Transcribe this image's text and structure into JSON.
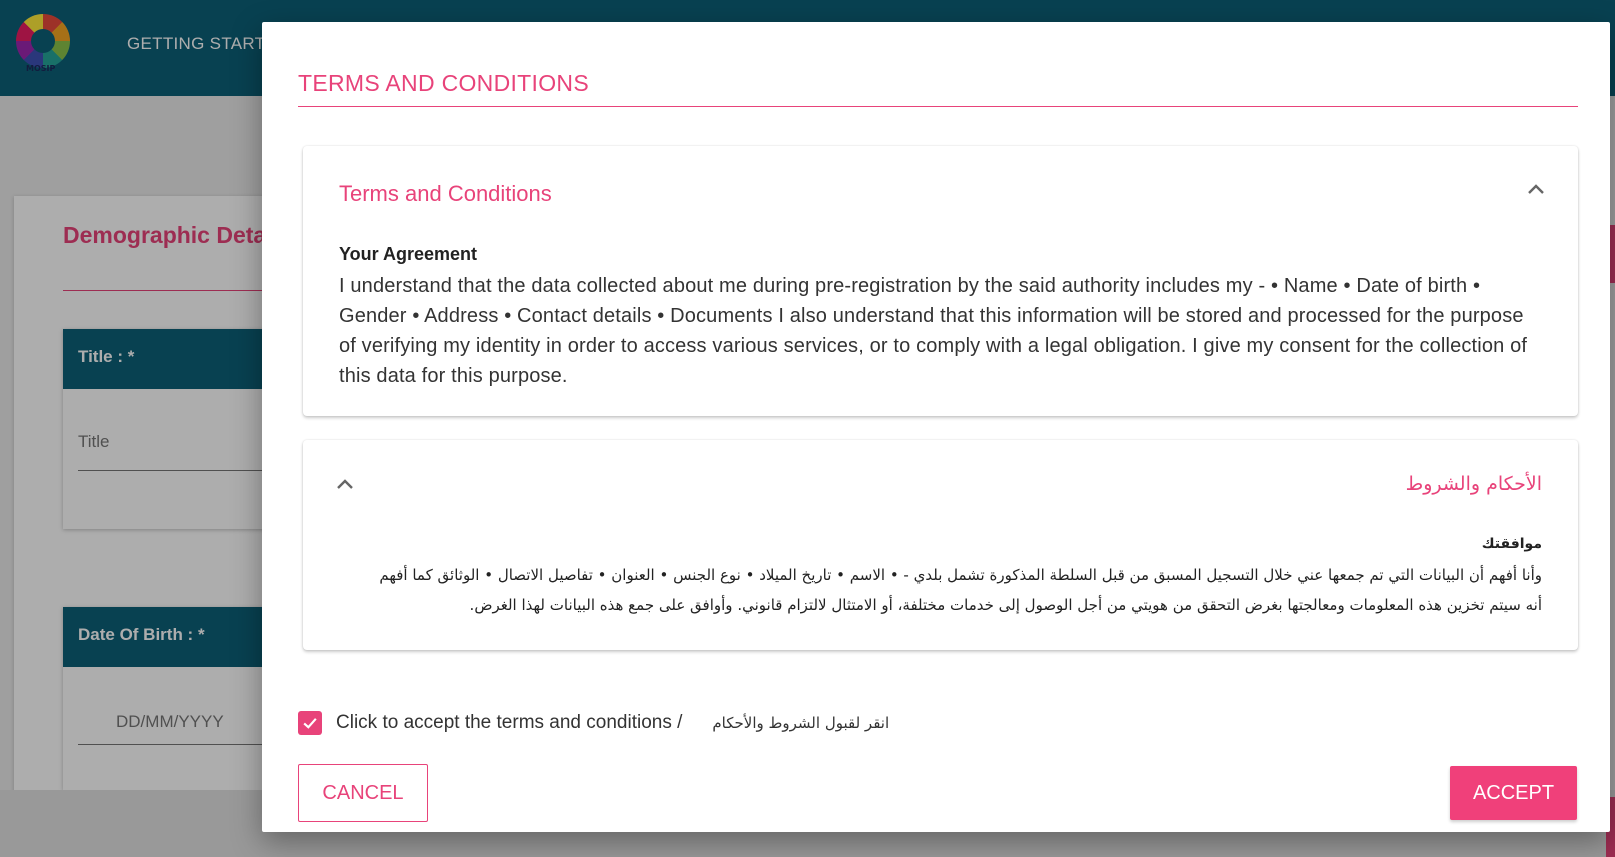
{
  "app": {
    "logo_text": "MOSIP",
    "nav_item": "GETTING STARTED",
    "section_heading": "Demographic Details",
    "fields": [
      {
        "label": "Title :  *",
        "placeholder": "Title"
      },
      {
        "label": "Date Of Birth :  *",
        "placeholder": "DD/MM/YYYY"
      }
    ]
  },
  "dialog": {
    "title": "TERMS AND CONDITIONS",
    "panels": [
      {
        "title": "Terms and Conditions",
        "heading": "Your Agreement",
        "body": "I understand that the data collected about me during pre-registration by the said authority includes my - • Name • Date of birth • Gender • Address • Contact details • Documents I also understand that this information will be stored and processed for the purpose of verifying my identity in order to access various services, or to comply with a legal obligation. I give my consent for the collection of this data for this purpose.",
        "chevron_icon": "chevron-up-icon"
      },
      {
        "title": "الأحكام والشروط",
        "heading": "موافقتك",
        "body": "وأنا أفهم أن البيانات التي تم جمعها عني خلال التسجيل المسبق من قبل السلطة المذكورة تشمل بلدي - • الاسم • تاريخ الميلاد • نوع الجنس • العنوان • تفاصيل الاتصال • الوثائق كما أفهم أنه سيتم تخزين هذه المعلومات ومعالجتها بغرض التحقق من هويتي من أجل الوصول إلى خدمات مختلفة، أو الامتثال لالتزام قانوني. وأوافق على جمع هذه البيانات لهذا الغرض.",
        "chevron_icon": "chevron-up-icon"
      }
    ],
    "accept_checkbox": {
      "checked": true,
      "label": "Click to accept the terms and conditions /",
      "label_ar": "انقر لقبول الشروط والأحكام"
    },
    "cancel_label": "CANCEL",
    "accept_label": "ACCEPT"
  },
  "colors": {
    "accent": "#e8437a",
    "header_bg": "#0d6078",
    "accept_button": "#f0407a"
  }
}
